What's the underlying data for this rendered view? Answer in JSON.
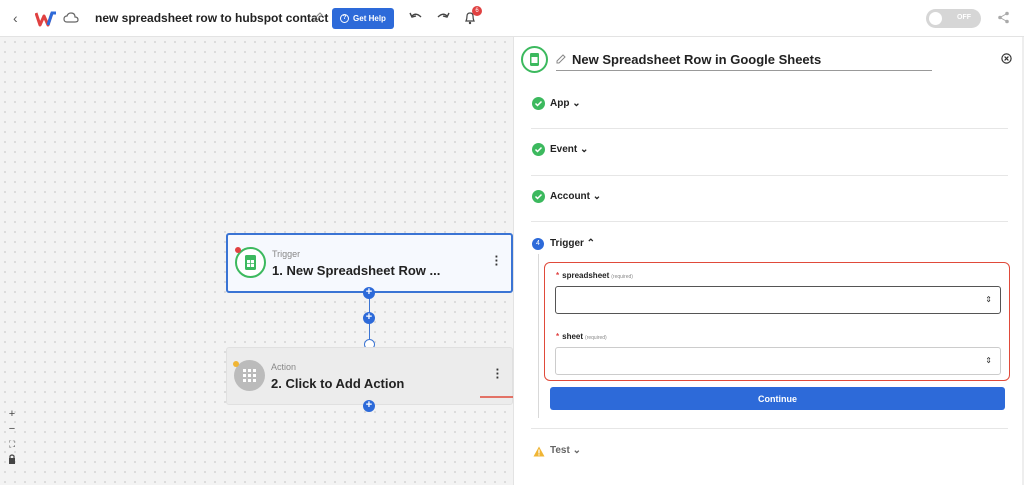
{
  "topbar": {
    "back_label": "‹",
    "flow_title": "new spreadsheet row to hubspot contact",
    "help_label": "Get Help",
    "notification_count": "6",
    "toggle_label": "OFF"
  },
  "canvas": {
    "trigger_card": {
      "kind": "Trigger",
      "name": "1. New Spreadsheet Row ..."
    },
    "action_card": {
      "kind": "Action",
      "name": "2. Click to Add Action"
    },
    "zoom_in": "+",
    "zoom_out": "−",
    "fit": "⛶",
    "lock": "🔒"
  },
  "panel": {
    "title": "New Spreadsheet Row in Google Sheets",
    "sections": [
      {
        "label": "App",
        "status": "done"
      },
      {
        "label": "Event",
        "status": "done"
      },
      {
        "label": "Account",
        "status": "done"
      }
    ],
    "trigger_section": {
      "step": "4",
      "label": "Trigger",
      "fields": [
        {
          "label": "spreadsheet",
          "required_text": "(required)",
          "value": ""
        },
        {
          "label": "sheet",
          "required_text": "(required)",
          "value": ""
        }
      ]
    },
    "continue_label": "Continue",
    "test_label": "Test"
  },
  "colors": {
    "accent": "#2d6ad9",
    "success": "#3cb95e",
    "error": "#e04141",
    "warning": "#f0b534"
  }
}
